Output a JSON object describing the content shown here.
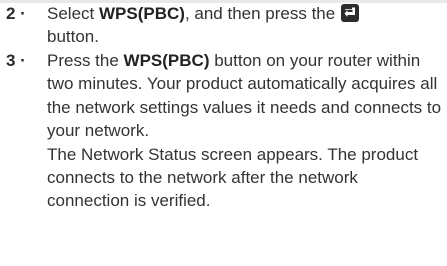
{
  "steps": [
    {
      "number": "2 ·",
      "text_before": "Select ",
      "bold": "WPS(PBC)",
      "text_after": ", and then press the ",
      "icon": "enter-icon",
      "text_end": "button."
    },
    {
      "number": "3 ·",
      "text_before": "Press the ",
      "bold": "WPS(PBC)",
      "text_after": " button on your router within two minutes. Your product automatically acquires all the network settings values it needs and connects to your network.",
      "second_paragraph": "The Network Status screen appears. The product connects to the network after the network connection is verified."
    }
  ]
}
